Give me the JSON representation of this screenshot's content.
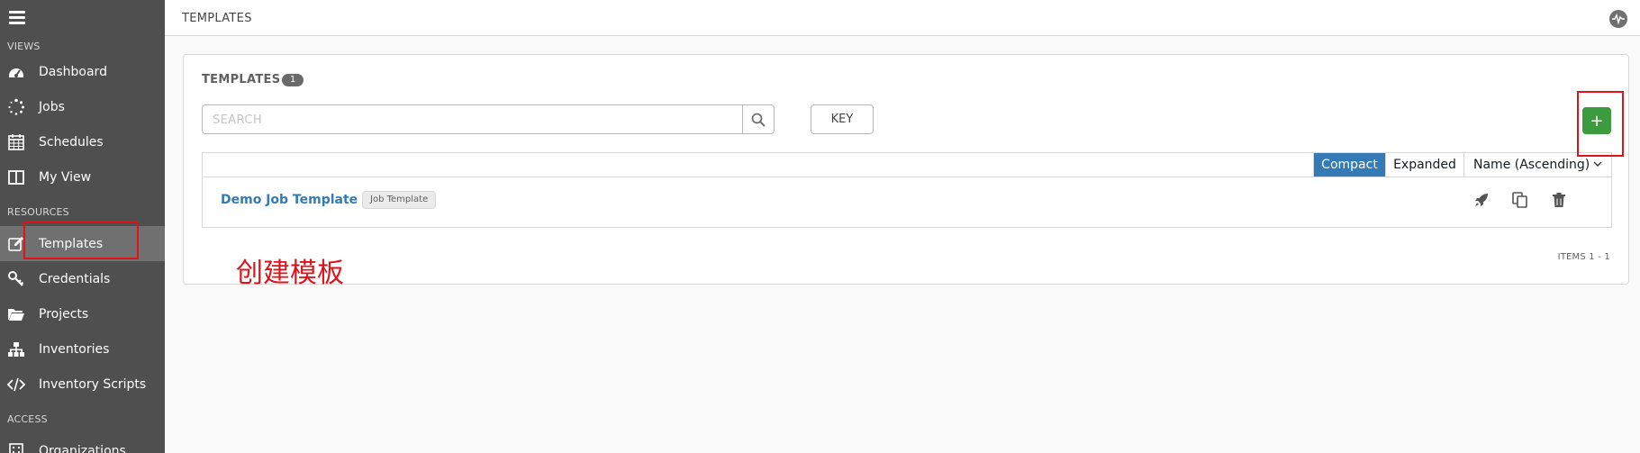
{
  "sidebar": {
    "sections": {
      "views": "VIEWS",
      "resources": "RESOURCES",
      "access": "ACCESS"
    },
    "items": [
      {
        "label": "Dashboard",
        "icon": "dashboard-icon"
      },
      {
        "label": "Jobs",
        "icon": "jobs-spinner-icon"
      },
      {
        "label": "Schedules",
        "icon": "calendar-icon"
      },
      {
        "label": "My View",
        "icon": "columns-icon"
      },
      {
        "label": "Templates",
        "icon": "edit-icon",
        "active": true
      },
      {
        "label": "Credentials",
        "icon": "key-icon"
      },
      {
        "label": "Projects",
        "icon": "folder-open-icon"
      },
      {
        "label": "Inventories",
        "icon": "sitemap-icon"
      },
      {
        "label": "Inventory Scripts",
        "icon": "code-icon"
      },
      {
        "label": "Organizations",
        "icon": "building-icon"
      }
    ]
  },
  "header": {
    "title": "TEMPLATES"
  },
  "panel": {
    "title": "TEMPLATES",
    "count": "1",
    "search_placeholder": "SEARCH",
    "key_label": "KEY",
    "add_label": "+"
  },
  "list": {
    "view_compact": "Compact",
    "view_expanded": "Expanded",
    "sort_label": "Name (Ascending)",
    "rows": [
      {
        "name": "Demo Job Template",
        "type": "Job Template"
      }
    ],
    "items_count": "ITEMS  1 - 1"
  },
  "annotation": {
    "text": "创建模板",
    "color": "#e1131a"
  },
  "colors": {
    "sidebar_bg": "#4f4f4f",
    "active_bg": "#707070",
    "link_blue": "#337ab7",
    "add_green": "#3c9a3f"
  }
}
